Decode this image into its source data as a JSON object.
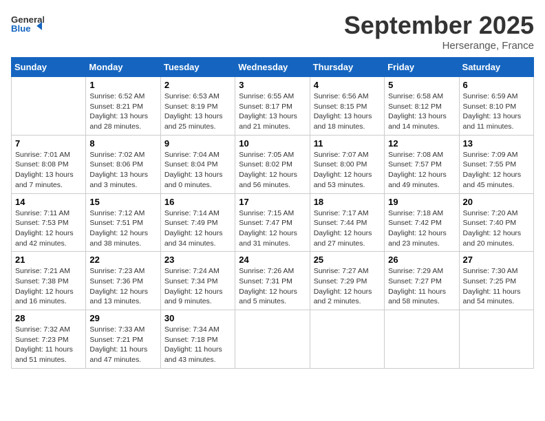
{
  "header": {
    "logo_line1": "General",
    "logo_line2": "Blue",
    "month": "September 2025",
    "location": "Herserange, France"
  },
  "weekdays": [
    "Sunday",
    "Monday",
    "Tuesday",
    "Wednesday",
    "Thursday",
    "Friday",
    "Saturday"
  ],
  "weeks": [
    [
      {
        "day": "",
        "info": ""
      },
      {
        "day": "1",
        "info": "Sunrise: 6:52 AM\nSunset: 8:21 PM\nDaylight: 13 hours and 28 minutes."
      },
      {
        "day": "2",
        "info": "Sunrise: 6:53 AM\nSunset: 8:19 PM\nDaylight: 13 hours and 25 minutes."
      },
      {
        "day": "3",
        "info": "Sunrise: 6:55 AM\nSunset: 8:17 PM\nDaylight: 13 hours and 21 minutes."
      },
      {
        "day": "4",
        "info": "Sunrise: 6:56 AM\nSunset: 8:15 PM\nDaylight: 13 hours and 18 minutes."
      },
      {
        "day": "5",
        "info": "Sunrise: 6:58 AM\nSunset: 8:12 PM\nDaylight: 13 hours and 14 minutes."
      },
      {
        "day": "6",
        "info": "Sunrise: 6:59 AM\nSunset: 8:10 PM\nDaylight: 13 hours and 11 minutes."
      }
    ],
    [
      {
        "day": "7",
        "info": "Sunrise: 7:01 AM\nSunset: 8:08 PM\nDaylight: 13 hours and 7 minutes."
      },
      {
        "day": "8",
        "info": "Sunrise: 7:02 AM\nSunset: 8:06 PM\nDaylight: 13 hours and 3 minutes."
      },
      {
        "day": "9",
        "info": "Sunrise: 7:04 AM\nSunset: 8:04 PM\nDaylight: 13 hours and 0 minutes."
      },
      {
        "day": "10",
        "info": "Sunrise: 7:05 AM\nSunset: 8:02 PM\nDaylight: 12 hours and 56 minutes."
      },
      {
        "day": "11",
        "info": "Sunrise: 7:07 AM\nSunset: 8:00 PM\nDaylight: 12 hours and 53 minutes."
      },
      {
        "day": "12",
        "info": "Sunrise: 7:08 AM\nSunset: 7:57 PM\nDaylight: 12 hours and 49 minutes."
      },
      {
        "day": "13",
        "info": "Sunrise: 7:09 AM\nSunset: 7:55 PM\nDaylight: 12 hours and 45 minutes."
      }
    ],
    [
      {
        "day": "14",
        "info": "Sunrise: 7:11 AM\nSunset: 7:53 PM\nDaylight: 12 hours and 42 minutes."
      },
      {
        "day": "15",
        "info": "Sunrise: 7:12 AM\nSunset: 7:51 PM\nDaylight: 12 hours and 38 minutes."
      },
      {
        "day": "16",
        "info": "Sunrise: 7:14 AM\nSunset: 7:49 PM\nDaylight: 12 hours and 34 minutes."
      },
      {
        "day": "17",
        "info": "Sunrise: 7:15 AM\nSunset: 7:47 PM\nDaylight: 12 hours and 31 minutes."
      },
      {
        "day": "18",
        "info": "Sunrise: 7:17 AM\nSunset: 7:44 PM\nDaylight: 12 hours and 27 minutes."
      },
      {
        "day": "19",
        "info": "Sunrise: 7:18 AM\nSunset: 7:42 PM\nDaylight: 12 hours and 23 minutes."
      },
      {
        "day": "20",
        "info": "Sunrise: 7:20 AM\nSunset: 7:40 PM\nDaylight: 12 hours and 20 minutes."
      }
    ],
    [
      {
        "day": "21",
        "info": "Sunrise: 7:21 AM\nSunset: 7:38 PM\nDaylight: 12 hours and 16 minutes."
      },
      {
        "day": "22",
        "info": "Sunrise: 7:23 AM\nSunset: 7:36 PM\nDaylight: 12 hours and 13 minutes."
      },
      {
        "day": "23",
        "info": "Sunrise: 7:24 AM\nSunset: 7:34 PM\nDaylight: 12 hours and 9 minutes."
      },
      {
        "day": "24",
        "info": "Sunrise: 7:26 AM\nSunset: 7:31 PM\nDaylight: 12 hours and 5 minutes."
      },
      {
        "day": "25",
        "info": "Sunrise: 7:27 AM\nSunset: 7:29 PM\nDaylight: 12 hours and 2 minutes."
      },
      {
        "day": "26",
        "info": "Sunrise: 7:29 AM\nSunset: 7:27 PM\nDaylight: 11 hours and 58 minutes."
      },
      {
        "day": "27",
        "info": "Sunrise: 7:30 AM\nSunset: 7:25 PM\nDaylight: 11 hours and 54 minutes."
      }
    ],
    [
      {
        "day": "28",
        "info": "Sunrise: 7:32 AM\nSunset: 7:23 PM\nDaylight: 11 hours and 51 minutes."
      },
      {
        "day": "29",
        "info": "Sunrise: 7:33 AM\nSunset: 7:21 PM\nDaylight: 11 hours and 47 minutes."
      },
      {
        "day": "30",
        "info": "Sunrise: 7:34 AM\nSunset: 7:18 PM\nDaylight: 11 hours and 43 minutes."
      },
      {
        "day": "",
        "info": ""
      },
      {
        "day": "",
        "info": ""
      },
      {
        "day": "",
        "info": ""
      },
      {
        "day": "",
        "info": ""
      }
    ]
  ]
}
